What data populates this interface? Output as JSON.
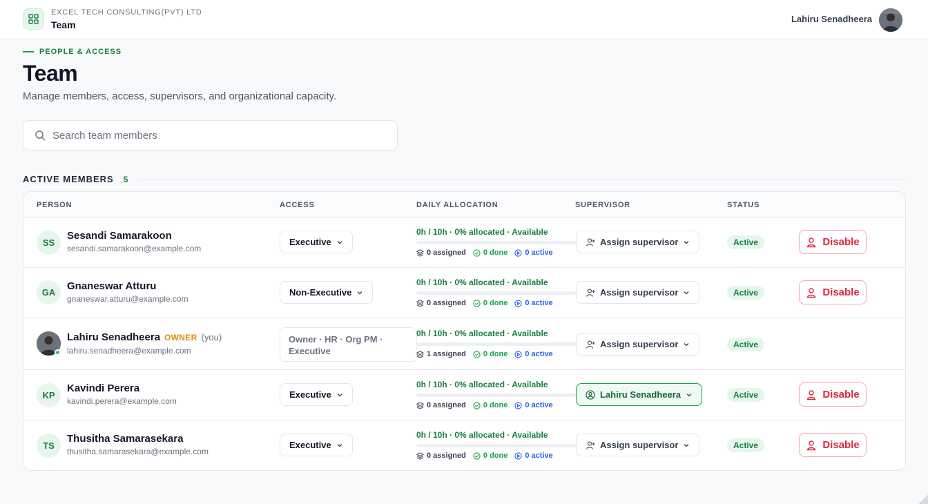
{
  "topbar": {
    "org_name": "EXCEL TECH CONSULTING(PVT) LTD",
    "title": "Team",
    "user_name": "Lahiru Senadheera",
    "brand_icon": "grid-icon"
  },
  "header": {
    "eyebrow": "PEOPLE & ACCESS",
    "title": "Team",
    "subtitle": "Manage members, access, supervisors, and organizational capacity."
  },
  "search": {
    "placeholder": "Search team members",
    "value": ""
  },
  "section": {
    "label": "ACTIVE MEMBERS",
    "count": "5"
  },
  "columns": {
    "person": "PERSON",
    "access": "ACCESS",
    "daily_allocation": "DAILY ALLOCATION",
    "supervisor": "SUPERVISOR",
    "status": "STATUS"
  },
  "colors": {
    "accent_green": "#15803d",
    "danger_red": "#dc2640",
    "owner_orange": "#ea8a0c",
    "active_blue": "#2563eb"
  },
  "members": [
    {
      "initials": "SS",
      "name": "Sesandi Samarakoon",
      "email": "sesandi.samarakoon@example.com",
      "access": "Executive",
      "allocation": "0h / 10h · 0% allocated · Available",
      "allocation_fraction": 0,
      "assigned": "0 assigned",
      "done": "0 done",
      "active": "0 active",
      "supervisor": "Assign supervisor",
      "status": "Active",
      "action": "Disable"
    },
    {
      "initials": "GA",
      "name": "Gnaneswar Atturu",
      "email": "gnaneswar.atturu@example.com",
      "access": "Non-Executive",
      "allocation": "0h / 10h · 0% allocated · Available",
      "allocation_fraction": 0,
      "assigned": "0 assigned",
      "done": "0 done",
      "active": "0 active",
      "supervisor": "Assign supervisor",
      "status": "Active",
      "action": "Disable"
    },
    {
      "initials": "",
      "name": "Lahiru Senadheera",
      "owner_badge": "OWNER",
      "you_label": "(you)",
      "email": "lahiru.senadheera@example.com",
      "access": "Owner · HR · Org PM · Executive",
      "allocation": "0h / 10h · 0% allocated · Available",
      "allocation_fraction": 0,
      "assigned": "1 assigned",
      "done": "0 done",
      "active": "0 active",
      "supervisor": "Assign supervisor",
      "status": "Active"
    },
    {
      "initials": "KP",
      "name": "Kavindi Perera",
      "email": "kavindi.perera@example.com",
      "access": "Executive",
      "allocation": "0h / 10h · 0% allocated · Available",
      "allocation_fraction": 0,
      "assigned": "0 assigned",
      "done": "0 done",
      "active": "0 active",
      "supervisor": "Lahiru Senadheera",
      "status": "Active",
      "action": "Disable"
    },
    {
      "initials": "TS",
      "name": "Thusitha Samarasekara",
      "email": "thusitha.samarasekara@example.com",
      "access": "Executive",
      "allocation": "0h / 10h · 0% allocated · Available",
      "allocation_fraction": 0,
      "assigned": "0 assigned",
      "done": "0 done",
      "active": "0 active",
      "supervisor": "Assign supervisor",
      "status": "Active",
      "action": "Disable"
    }
  ]
}
